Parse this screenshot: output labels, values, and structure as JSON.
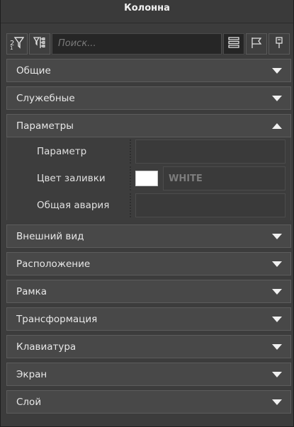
{
  "panel": {
    "title": "Колонна"
  },
  "toolbar": {
    "search_placeholder": "Поиск...",
    "icons": [
      "filter-sort-icon",
      "tree-filter-icon",
      "list-view-icon",
      "flag-icon",
      "pin-icon"
    ]
  },
  "sections": [
    {
      "label": "Общие",
      "expanded": false
    },
    {
      "label": "Служебные",
      "expanded": false
    },
    {
      "label": "Параметры",
      "expanded": true
    },
    {
      "label": "Внешний вид",
      "expanded": false
    },
    {
      "label": "Расположение",
      "expanded": false
    },
    {
      "label": "Рамка",
      "expanded": false
    },
    {
      "label": "Трансформация",
      "expanded": false
    },
    {
      "label": "Клавиатура",
      "expanded": false
    },
    {
      "label": "Экран",
      "expanded": false
    },
    {
      "label": "Слой",
      "expanded": false
    }
  ],
  "parameters": {
    "param_label": "Параметр",
    "param_value": "",
    "fill_color_label": "Цвет заливки",
    "fill_color_value": "WHITE",
    "fill_color_hex": "#ffffff",
    "alarm_label": "Общая авария",
    "alarm_value": ""
  },
  "colors": {
    "panel_bg": "#3c3c3c",
    "header_bg": "#484848",
    "text": "#e8e8e8",
    "muted_value": "#7c7c7c"
  }
}
